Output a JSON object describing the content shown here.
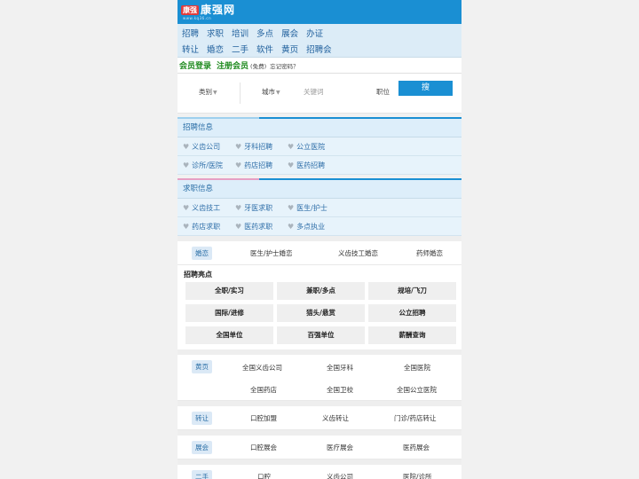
{
  "header": {
    "logo_badge": "康强",
    "logo_text": "康强网",
    "logo_url": "www.kq36.cn"
  },
  "nav": {
    "row1": [
      "招聘",
      "求职",
      "培训",
      "多点",
      "展会",
      "办证"
    ],
    "row2": [
      "转让",
      "婚恋",
      "二手",
      "软件",
      "黄页",
      "招聘会"
    ]
  },
  "member": {
    "login": "会员登录",
    "register": "注册会员",
    "free": "(免费)",
    "forgot": "忘记密码？"
  },
  "search": {
    "category": "类别",
    "city": "城市",
    "keyword_placeholder": "关键词",
    "position": "职位",
    "button": "搜"
  },
  "recruit": {
    "title": "招聘信息",
    "rows": [
      [
        "义齿公司",
        "牙科招聘",
        "公立医院"
      ],
      [
        "诊所/医院",
        "药店招聘",
        "医药招聘"
      ]
    ]
  },
  "jobseek": {
    "title": "求职信息",
    "rows": [
      [
        "义齿技工",
        "牙医求职",
        "医生/护士"
      ],
      [
        "药店求职",
        "医药求职",
        "多点执业"
      ]
    ]
  },
  "marriage": {
    "tag": "婚恋",
    "items": [
      "医生/护士婚恋",
      "义齿技工婚恋",
      "药师婚恋"
    ]
  },
  "highlights": {
    "title": "招聘亮点",
    "items": [
      "全职/实习",
      "兼职/多点",
      "规培/飞刀",
      "国际/进修",
      "猎头/悬赏",
      "公立招聘",
      "全国单位",
      "百强单位",
      "薪酬查询"
    ]
  },
  "yellow": {
    "tag": "黄页",
    "items": [
      "全国义齿公司",
      "全国牙科",
      "全国医院",
      "全国药店",
      "全国卫校",
      "全国公立医院"
    ]
  },
  "transfer": {
    "tag": "转让",
    "items": [
      "口腔加盟",
      "义齿转让",
      "门诊/药店转让"
    ]
  },
  "expo": {
    "tag": "展会",
    "items": [
      "口腔展会",
      "医疗展会",
      "医药展会"
    ]
  },
  "secondhand": {
    "tag": "二手",
    "items": [
      "口腔",
      "义齿公司",
      "医院/诊所"
    ]
  },
  "colors": {
    "brand": "#1a8fd3",
    "accent_pink": "#e6a0c4",
    "green": "#1e8a1e"
  }
}
